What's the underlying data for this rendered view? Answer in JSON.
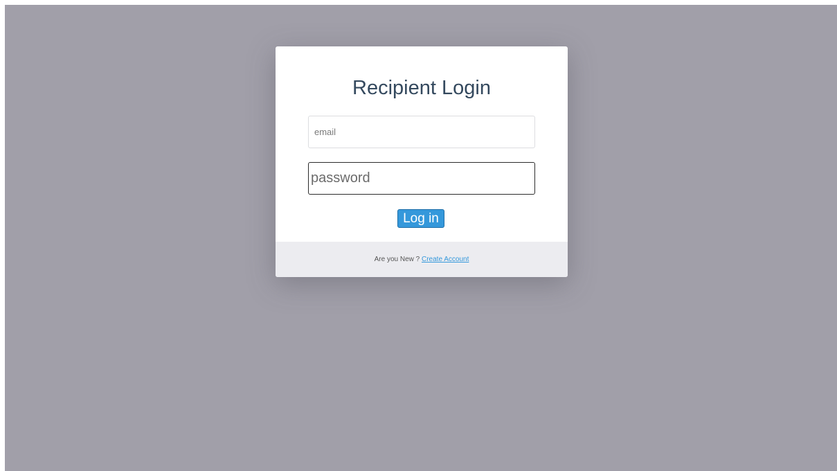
{
  "login": {
    "title": "Recipient Login",
    "email_placeholder": "email",
    "password_placeholder": "password",
    "login_button": "Log in",
    "footer_prompt": "Are you New ?",
    "create_account_link": "Create Account"
  },
  "colors": {
    "backdrop": "#a19fa9",
    "card": "#ffffff",
    "title_text": "#34495e",
    "accent": "#3498db",
    "footer_background": "#ececf0"
  }
}
